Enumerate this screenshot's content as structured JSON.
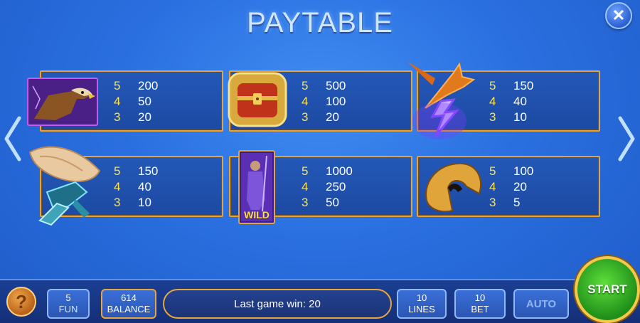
{
  "title": "PAYTABLE",
  "close_icon": "close-icon",
  "symbols": [
    {
      "name": "eagle",
      "pays": [
        {
          "count": "5",
          "value": "200"
        },
        {
          "count": "4",
          "value": "50"
        },
        {
          "count": "3",
          "value": "20"
        }
      ]
    },
    {
      "name": "treasure-chest",
      "pays": [
        {
          "count": "5",
          "value": "500"
        },
        {
          "count": "4",
          "value": "100"
        },
        {
          "count": "3",
          "value": "20"
        }
      ]
    },
    {
      "name": "trident-lightning",
      "pays": [
        {
          "count": "5",
          "value": "150"
        },
        {
          "count": "4",
          "value": "40"
        },
        {
          "count": "3",
          "value": "10"
        }
      ]
    },
    {
      "name": "conch-shell",
      "pays": [
        {
          "count": "5",
          "value": "150"
        },
        {
          "count": "4",
          "value": "40"
        },
        {
          "count": "3",
          "value": "10"
        }
      ]
    },
    {
      "name": "poseidon-wild",
      "badge": "WILD",
      "pays": [
        {
          "count": "5",
          "value": "1000"
        },
        {
          "count": "4",
          "value": "250"
        },
        {
          "count": "3",
          "value": "50"
        }
      ]
    },
    {
      "name": "spartan-helmet",
      "pays": [
        {
          "count": "5",
          "value": "100"
        },
        {
          "count": "4",
          "value": "20"
        },
        {
          "count": "3",
          "value": "5"
        }
      ]
    }
  ],
  "bottom": {
    "help": "?",
    "fun_value": "5",
    "fun_label": "FUN",
    "balance_value": "614",
    "balance_label": "BALANCE",
    "last_win": "Last game win: 20",
    "lines_value": "10",
    "lines_label": "LINES",
    "bet_value": "10",
    "bet_label": "BET",
    "auto": "AUTO",
    "start": "START"
  },
  "colors": {
    "accent_gold": "#e2a441",
    "count_yellow": "#ffe14a",
    "start_green": "#2fae22"
  }
}
